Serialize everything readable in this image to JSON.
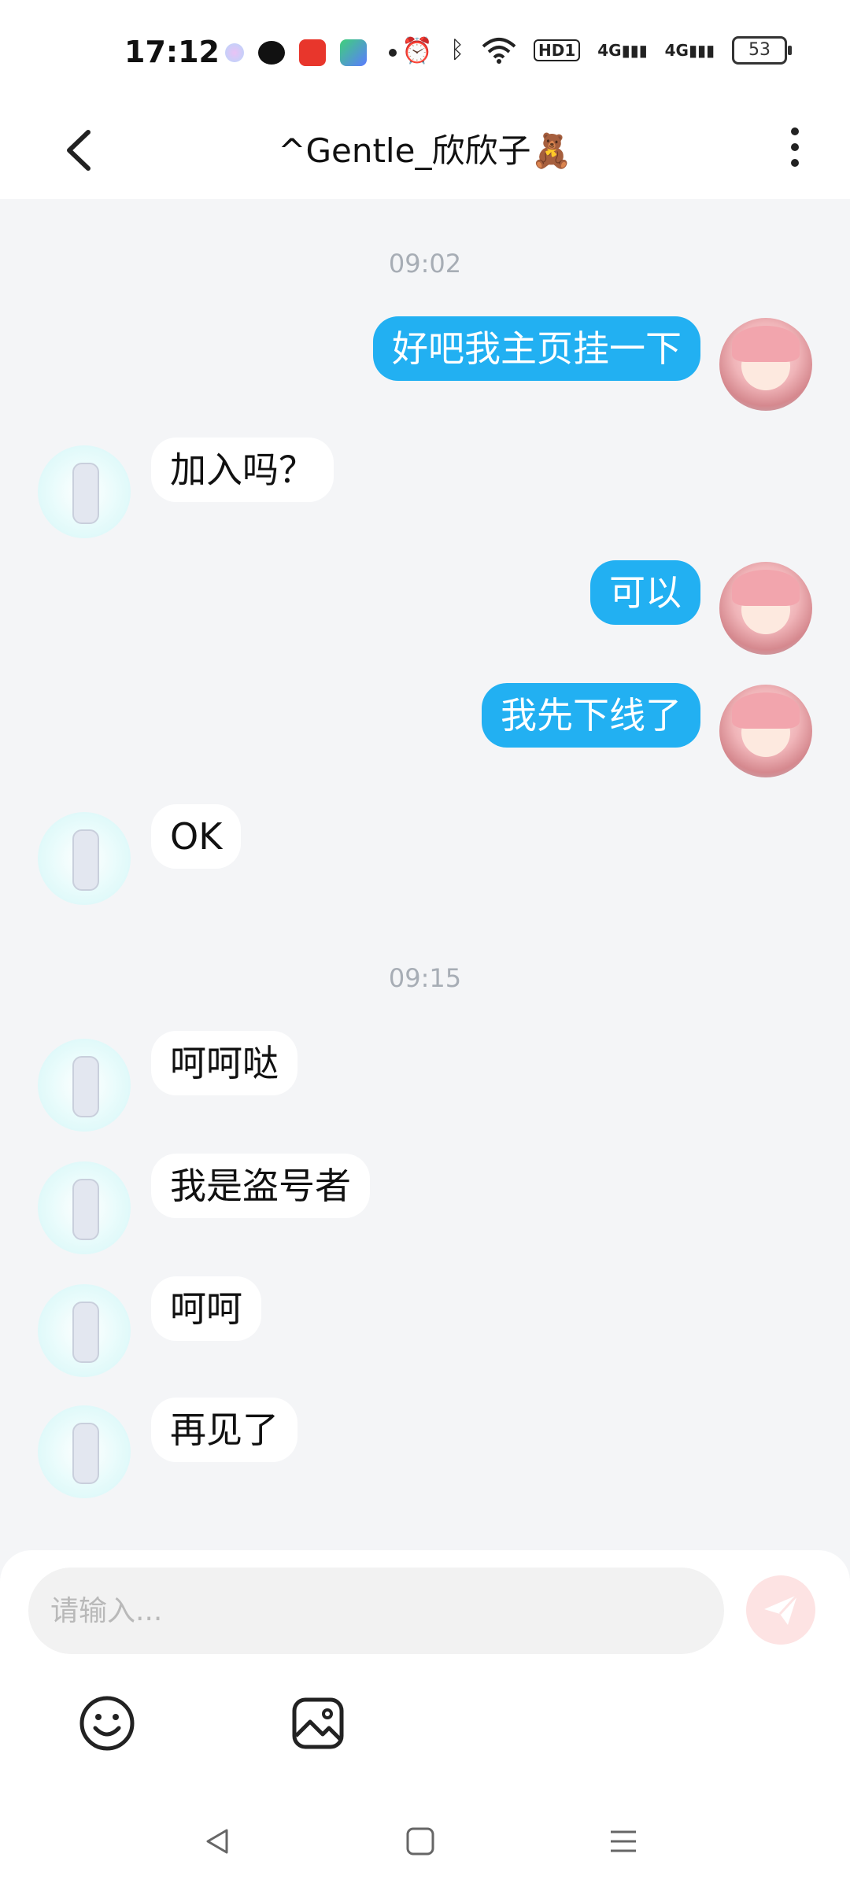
{
  "status_bar": {
    "time": "17:12",
    "battery": "53",
    "net1": "4G",
    "net2": "4G",
    "hd": "HD1"
  },
  "header": {
    "title": "^Gentle_欣欣子🧸"
  },
  "messages": {
    "ts1": "09:02",
    "m1": "好吧我主页挂一下",
    "m2": "加入吗？",
    "m3": "可以",
    "m4": "我先下线了",
    "m5": "OK",
    "ts2": "09:15",
    "m6": "呵呵哒",
    "m7": "我是盗号者",
    "m8": "呵呵",
    "m9": "再见了"
  },
  "composer": {
    "placeholder": "请输入..."
  },
  "colors": {
    "accent": "#22b0f2",
    "background": "#f4f5f7",
    "send_button": "#fde3e3"
  },
  "icons": {
    "back": "chevron-left-icon",
    "more": "more-vertical-icon",
    "send": "send-icon",
    "emoji": "smiley-icon",
    "image": "image-icon"
  }
}
